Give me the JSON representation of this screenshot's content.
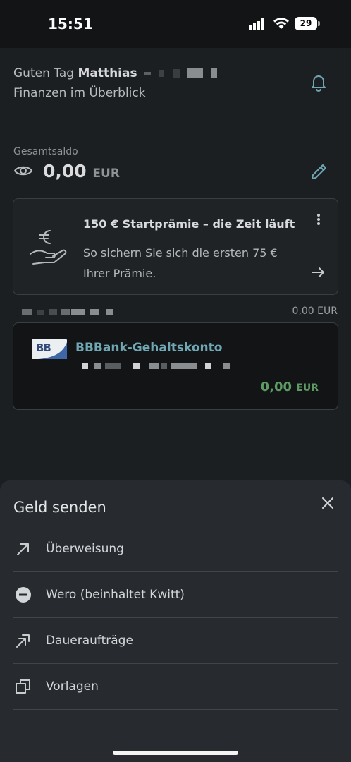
{
  "status_bar": {
    "time": "15:51",
    "battery": "29"
  },
  "header": {
    "greeting_prefix": "Guten Tag",
    "user_name": "Matthias",
    "subtitle": "Finanzen im Überblick"
  },
  "balance": {
    "label": "Gesamtsaldo",
    "amount": "0,00",
    "currency": "EUR"
  },
  "promo": {
    "title": "150 € Startprämie – die Zeit läuft",
    "text": "So sichern Sie sich die ersten 75 € Ihrer Prämie."
  },
  "account_group": {
    "total": "0,00 EUR"
  },
  "account": {
    "logo_text": "BB",
    "name": "BBBank-Gehaltskonto",
    "balance": "0,00",
    "currency": "EUR"
  },
  "sheet": {
    "title": "Geld senden",
    "items": [
      {
        "label": "Überweisung",
        "icon": "arrow-up-right-icon"
      },
      {
        "label": "Wero (beinhaltet Kwitt)",
        "icon": "wero-icon"
      },
      {
        "label": "Daueraufträge",
        "icon": "double-arrow-icon"
      },
      {
        "label": "Vorlagen",
        "icon": "copy-icon"
      }
    ]
  },
  "colors": {
    "accent": "#6fa7b4",
    "positive": "#5d9a64",
    "sheet_bg": "#272b2f"
  }
}
